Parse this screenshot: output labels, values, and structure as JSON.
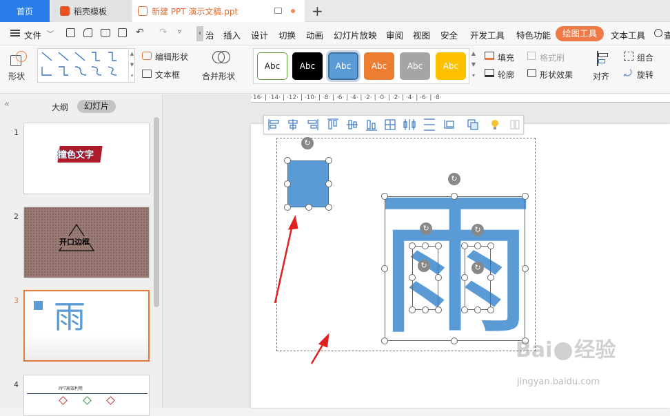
{
  "tabs": {
    "home": "首页",
    "template": "稻壳模板",
    "document": "新建 PPT 演示文稿.ppt",
    "new_tab": "+"
  },
  "menu": {
    "file": "文件",
    "items": [
      "治",
      "插入",
      "设计",
      "切换",
      "动画",
      "幻灯片放映",
      "审阅",
      "视图",
      "安全",
      "开发工具",
      "特色功能"
    ],
    "active": "绘图工具",
    "text_tool": "文本工具",
    "search_fragment": "查"
  },
  "ribbon": {
    "shape": "形状",
    "edit_shape": "编辑形状",
    "text_box": "文本框",
    "merge_shape": "合并形状",
    "styles": [
      "Abc",
      "Abc",
      "Abc",
      "Abc",
      "Abc",
      "Abc"
    ],
    "fill": "填充",
    "format_brush": "格式刷",
    "outline": "轮廓",
    "shape_effect": "形状效果",
    "align": "对齐",
    "group": "组合",
    "rotate": "旋转"
  },
  "left_panel": {
    "outline_tab": "大纲",
    "slides_tab": "幻灯片",
    "slides": [
      {
        "num": "1",
        "title": "撞色文字"
      },
      {
        "num": "2",
        "title": "开口边框"
      },
      {
        "num": "3",
        "title": "雨"
      },
      {
        "num": "4",
        "title": "PPT高效利用"
      }
    ]
  },
  "ruler": {
    "ticks": "·16· | ·14· | ·12· | ·10· | ·8· | ·6· | ·4· | ·2· | ·0· | ·2· | ·4· | ·6· | ·8·"
  },
  "slide": {
    "character": "雨"
  },
  "watermark": {
    "brand": "Bai",
    "brand2": "经验",
    "url": "jingyan.baidu.com"
  },
  "colors": {
    "accent": "#2b7de9",
    "drawing_tools": "#ef7a48",
    "shape_blue": "#5b9bd5",
    "arrow_red": "#e02020",
    "selected_slide": "#e07a3b"
  }
}
